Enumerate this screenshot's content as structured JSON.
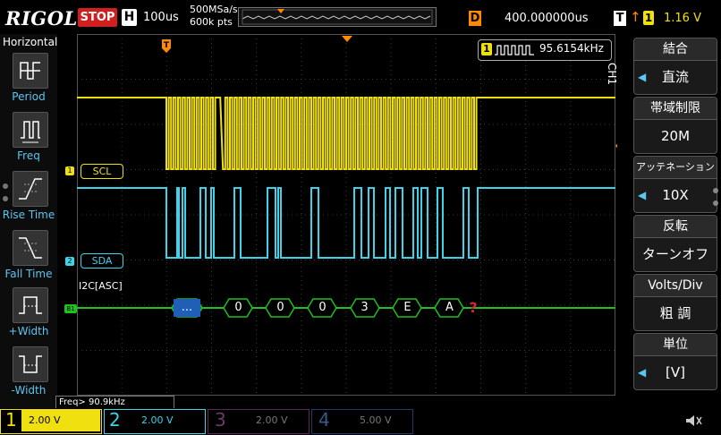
{
  "header": {
    "logo": "RIGOL",
    "run_state": "STOP",
    "h_label": "H",
    "timebase": "100us",
    "sample_rate": "500MSa/s",
    "memory_depth": "600k pts",
    "delay_label": "D",
    "delay": "400.000000us",
    "trigger_label": "T",
    "trigger_slope": "↑",
    "trigger_source": "1",
    "trigger_level": "1.16 V"
  },
  "left_menu": {
    "title": "Horizontal",
    "items": [
      {
        "label": "Period",
        "icon": "period-icon"
      },
      {
        "label": "Freq",
        "icon": "freq-icon"
      },
      {
        "label": "Rise Time",
        "icon": "rise-time-icon"
      },
      {
        "label": "Fall Time",
        "icon": "fall-time-icon"
      },
      {
        "label": "+Width",
        "icon": "pos-width-icon"
      },
      {
        "label": "-Width",
        "icon": "neg-width-icon"
      }
    ]
  },
  "measurement": {
    "channel": "1",
    "value": "95.6154kHz"
  },
  "traces": {
    "scl_label": "SCL",
    "scl_marker": "1",
    "sda_label": "SDA",
    "sda_marker": "2",
    "bus_label": "I2C[ASC]",
    "bus_marker": "B1",
    "trigger_marker": "T",
    "decode": [
      "...",
      "0",
      "0",
      "0",
      "3",
      "E",
      "A"
    ],
    "error_marker": "?"
  },
  "right_menu": {
    "channel": "CH1",
    "items": [
      {
        "title": "結合",
        "value": "直流",
        "arrow": true
      },
      {
        "title": "帯域制限",
        "value": "20M",
        "arrow": false
      },
      {
        "title": "アッテネーション",
        "value": "10X",
        "arrow": true
      },
      {
        "title": "反転",
        "value": "ターンオフ",
        "arrow": false
      },
      {
        "title": "Volts/Div",
        "value": "粗 調",
        "arrow": false
      },
      {
        "title": "単位",
        "value": "[V]",
        "arrow": true
      }
    ]
  },
  "freq_status": "Freq> 90.9kHz",
  "channels": [
    {
      "num": "1",
      "scale": "2.00 V",
      "color": "#f0e010"
    },
    {
      "num": "2",
      "scale": "2.00 V",
      "color": "#3bd4e8"
    },
    {
      "num": "3",
      "scale": "2.00 V",
      "color": "#d23cd2"
    },
    {
      "num": "4",
      "scale": "5.00 V",
      "color": "#3a7bd5"
    }
  ],
  "colors": {
    "ch1": "#f0e010",
    "ch2": "#3bd4e8",
    "bus": "#1fc01f",
    "trigger": "#ff8a00",
    "accent": "#5cc6f2"
  }
}
